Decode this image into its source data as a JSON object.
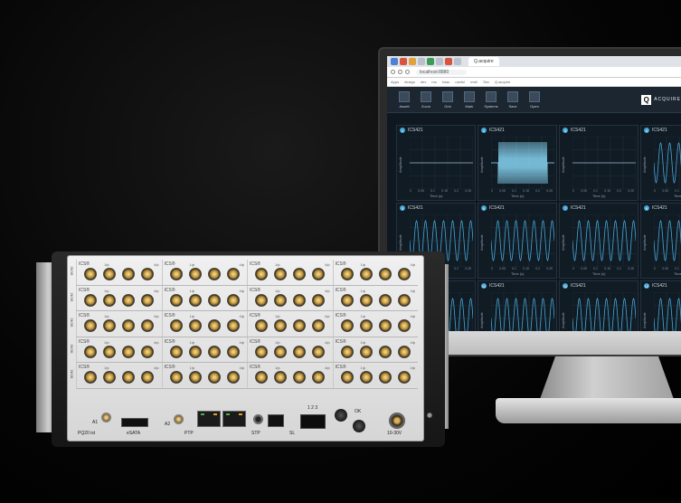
{
  "browser": {
    "tab_title": "Q.acquire",
    "url": "localhost:8880",
    "bookmarks": [
      "Apps",
      "design",
      "dev",
      "ms",
      "imao",
      "useful",
      "mvill",
      "Sec",
      "Q.acquire"
    ]
  },
  "app": {
    "toolbar": [
      {
        "label": "Assett",
        "icon": "assets-icon"
      },
      {
        "label": "Zoom",
        "icon": "zoom-icon"
      },
      {
        "label": "Grid",
        "icon": "grid-icon"
      },
      {
        "label": "Mark",
        "icon": "marker-icon"
      },
      {
        "label": "Systems",
        "icon": "systems-icon"
      },
      {
        "label": "Save",
        "icon": "save-icon"
      },
      {
        "label": "Open",
        "icon": "open-icon"
      }
    ],
    "logo_mark": "Q",
    "logo_text": "ACQUIRE",
    "ylabel": "Amplitude",
    "xlabel": "Time (s)",
    "xticks": [
      "0",
      "0.05",
      "0.1",
      "0.15",
      "0.2",
      "0.25"
    ],
    "panels": [
      {
        "num": "1",
        "title": "ICS421",
        "signal": "flat"
      },
      {
        "num": "2",
        "title": "ICS421",
        "signal": "burst"
      },
      {
        "num": "3",
        "title": "ICS421",
        "signal": "flat"
      },
      {
        "num": "4",
        "title": "ICS421",
        "signal": "sine"
      },
      {
        "num": "5",
        "title": "ICS421",
        "signal": "sine"
      },
      {
        "num": "6",
        "title": "ICS421",
        "signal": "sine"
      },
      {
        "num": "7",
        "title": "ICS421",
        "signal": "sine"
      },
      {
        "num": "8",
        "title": "ICS421",
        "signal": "sine"
      },
      {
        "num": "9",
        "title": "ICS421",
        "signal": "sine"
      },
      {
        "num": "10",
        "title": "ICS421",
        "signal": "sine"
      },
      {
        "num": "11",
        "title": "ICS421",
        "signal": "sine"
      },
      {
        "num": "12",
        "title": "ICS421",
        "signal": "sine"
      }
    ],
    "accent_color": "#46a6d6",
    "burst_color": "#8fe0ff"
  },
  "device": {
    "modules": [
      {
        "label": "SC42",
        "ics": "ICS®",
        "ch_first": "1ф",
        "ch_last": "4ф"
      },
      {
        "label": "SC42",
        "ics": "ICS®",
        "ch_first": "1ф",
        "ch_last": "4ф"
      },
      {
        "label": "SC42",
        "ics": "ICS®",
        "ch_first": "1ф",
        "ch_last": "4ф"
      },
      {
        "label": "SC42",
        "ics": "ICS®",
        "ch_first": "1ф",
        "ch_last": "4ф"
      },
      {
        "label": "SC42",
        "ics": "ICS®",
        "ch_first": "1ф",
        "ch_last": "4ф"
      }
    ],
    "ports": {
      "a1": "A1",
      "esata": "eSATA",
      "a2": "A2",
      "ptp": "PTP",
      "stp": "STP",
      "sl": "SL",
      "sfp_nums": "1  2  3",
      "ok": "OK",
      "power": "10-30V",
      "model": "PQ20 ist"
    }
  }
}
